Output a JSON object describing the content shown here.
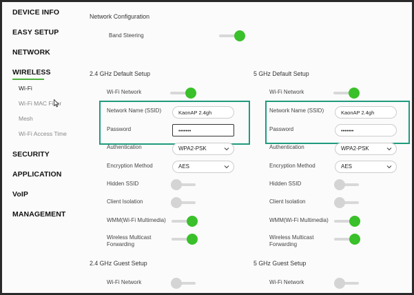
{
  "sidebar": {
    "main": [
      {
        "label": "DEVICE INFO"
      },
      {
        "label": "EASY SETUP"
      },
      {
        "label": "NETWORK"
      },
      {
        "label": "WIRELESS"
      },
      {
        "label": "SECURITY"
      },
      {
        "label": "APPLICATION"
      },
      {
        "label": "VoIP"
      },
      {
        "label": "MANAGEMENT"
      }
    ],
    "wireless_sub": [
      {
        "label": "Wi-Fi"
      },
      {
        "label": "Wi-Fi MAC Filter"
      },
      {
        "label": "Mesh"
      },
      {
        "label": "Wi-Fi Access Time"
      }
    ]
  },
  "network_config": {
    "title": "Network Configuration",
    "band_steering_label": "Band Steering",
    "band_steering_on": true
  },
  "band24": {
    "title": "2.4 GHz Default Setup",
    "wifi_network_label": "Wi-Fi Network",
    "ssid_label": "Network Name (SSID)",
    "ssid_value": "KaonAP 2.4gh",
    "password_label": "Password",
    "password_value": "•••••••",
    "auth_label": "Authentication",
    "auth_value": "WPA2-PSK",
    "encryption_label": "Encryption Method",
    "encryption_value": "AES",
    "hidden_ssid_label": "Hidden SSID",
    "client_isolation_label": "Client Isolation",
    "wmm_label": "WMM(Wi-Fi Multimedia)",
    "multicast_label": "Wireless Multicast Forwarding"
  },
  "band5": {
    "title": "5 GHz Default Setup",
    "wifi_network_label": "Wi-Fi Network",
    "ssid_label": "Network Name (SSID)",
    "ssid_value": "KaonAP 2.4gh",
    "password_label": "Password",
    "password_value": "•••••••",
    "auth_label": "Authentication",
    "auth_value": "WPA2-PSK",
    "encryption_label": "Encryption Method",
    "encryption_value": "AES",
    "hidden_ssid_label": "Hidden SSID",
    "client_isolation_label": "Client Isolation",
    "wmm_label": "WMM(Wi-Fi Multimedia)",
    "multicast_label": "Wireless Multicast Forwarding"
  },
  "guest24": {
    "title": "2.4 GHz Guest Setup",
    "wifi_network_label": "Wi-Fi Network"
  },
  "guest5": {
    "title": "5 GHz Guest Setup",
    "wifi_network_label": "Wi-Fi Network"
  },
  "colors": {
    "accent_green": "#3ac02a",
    "highlight_teal": "#1e9a7c"
  }
}
